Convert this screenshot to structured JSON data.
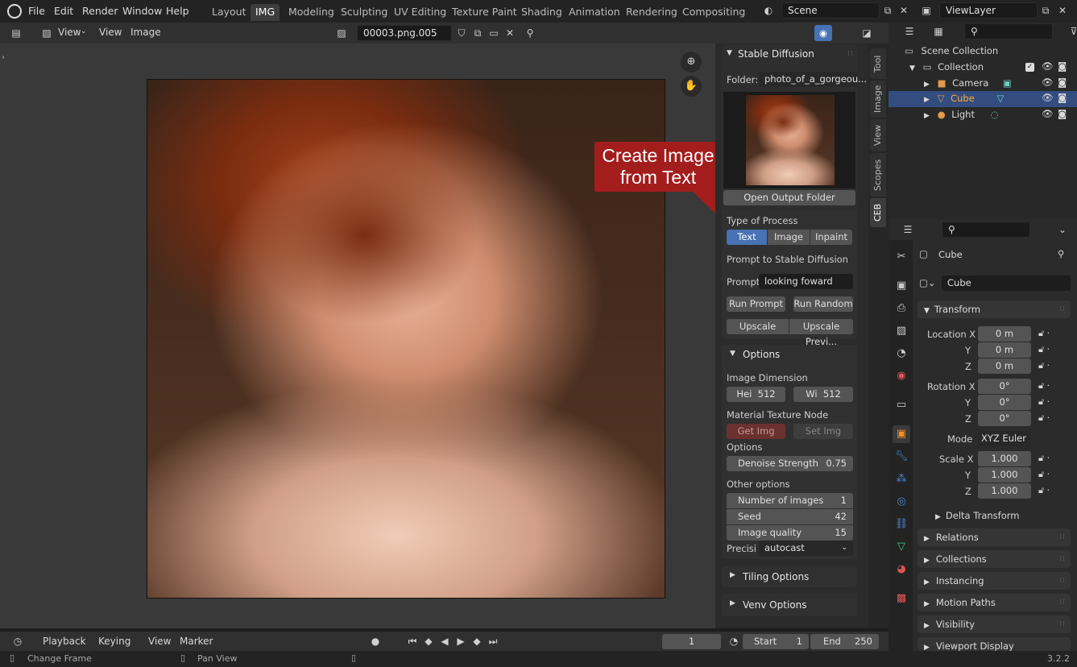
{
  "topbar": {
    "menus": [
      "File",
      "Edit",
      "Render",
      "Window",
      "Help"
    ],
    "workspaces": [
      "Layout",
      "IMG",
      "Modeling",
      "Sculpting",
      "UV Editing",
      "Texture Paint",
      "Shading",
      "Animation",
      "Rendering",
      "Compositing"
    ],
    "active_workspace": "IMG",
    "scene": "Scene",
    "viewlayer": "ViewLayer"
  },
  "image_editor": {
    "view_mode": "View",
    "menus": [
      "View",
      "Image"
    ],
    "image_name": "00003.png.005"
  },
  "callout": {
    "line1": "Create Image",
    "line2": "from Text"
  },
  "ntabs": [
    "Tool",
    "Image",
    "View",
    "Scopes",
    "CEB"
  ],
  "sd": {
    "title": "Stable Diffusion",
    "folder_label": "Folder:",
    "folder_value": "photo_of_a_gorgeou...",
    "open_output": "Open Output Folder",
    "type_label": "Type of Process",
    "types": [
      "Text",
      "Image",
      "Inpaint"
    ],
    "prompt_heading": "Prompt to Stable Diffusion",
    "prompt_label": "Prompt:",
    "prompt_value": "looking foward",
    "run_prompt": "Run Prompt",
    "run_random": "Run Random",
    "upscale": "Upscale",
    "upscale_preview": "Upscale Previ...",
    "options_title": "Options",
    "dim_label": "Image Dimension",
    "hei_label": "Hei",
    "hei_value": "512",
    "wi_label": "Wi",
    "wi_value": "512",
    "mat_label": "Material Texture Node",
    "get_img": "Get Img",
    "set_img": "Set Img",
    "options_label": "Options",
    "denoise_label": "Denoise Strength",
    "denoise_value": "0.75",
    "other_label": "Other options",
    "num_label": "Number of images",
    "num_value": "1",
    "seed_label": "Seed",
    "seed_value": "42",
    "quality_label": "Image quality",
    "quality_value": "15",
    "precision_label": "Precisi",
    "precision_value": "autocast",
    "tiling": "Tiling Options",
    "venv": "Venv Options"
  },
  "outliner": {
    "scene_collection": "Scene Collection",
    "collection": "Collection",
    "items": [
      "Camera",
      "Cube",
      "Light"
    ]
  },
  "properties": {
    "object_name": "Cube",
    "data_name": "Cube",
    "transform": "Transform",
    "loc_label": "Location X",
    "loc": [
      "0 m",
      "0 m",
      "0 m"
    ],
    "rot_label": "Rotation X",
    "rot": [
      "0°",
      "0°",
      "0°"
    ],
    "mode_label": "Mode",
    "mode_value": "XYZ Euler",
    "scale_label": "Scale X",
    "scale": [
      "1.000",
      "1.000",
      "1.000"
    ],
    "y": "Y",
    "z": "Z",
    "delta": "Delta Transform",
    "sections": [
      "Relations",
      "Collections",
      "Instancing",
      "Motion Paths",
      "Visibility",
      "Viewport Display"
    ]
  },
  "timeline": {
    "menus": [
      "Playback",
      "Keying",
      "View",
      "Marker"
    ],
    "frame": "1",
    "start_label": "Start",
    "start": "1",
    "end_label": "End",
    "end": "250"
  },
  "status": {
    "change_frame": "Change Frame",
    "pan_view": "Pan View",
    "version": "3.2.2"
  }
}
